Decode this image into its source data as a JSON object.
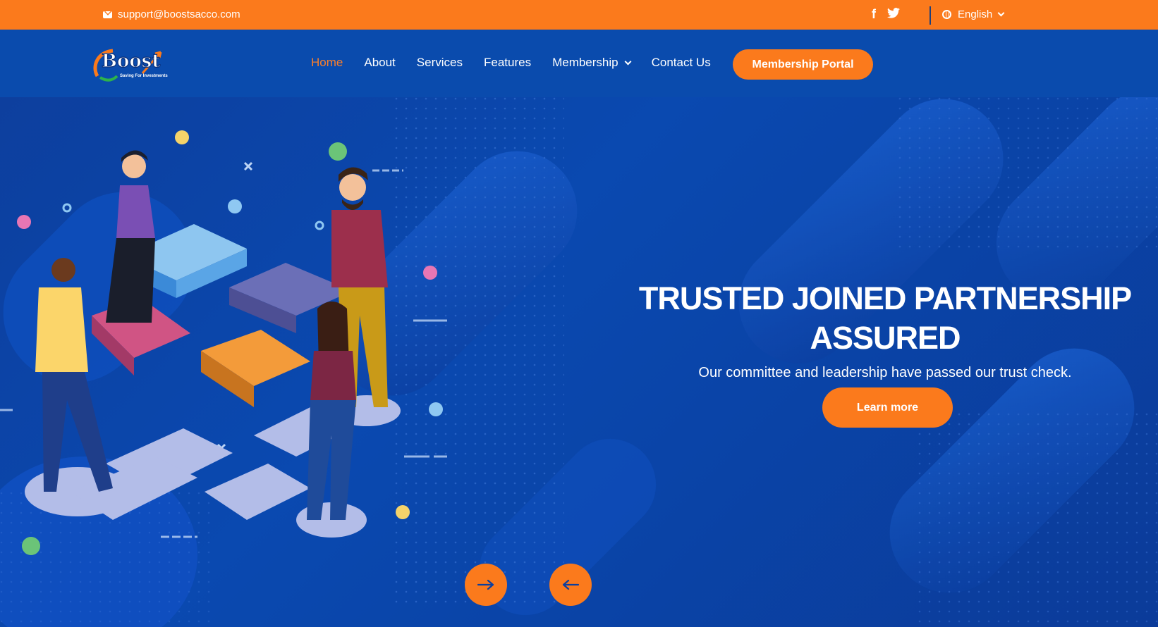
{
  "topbar": {
    "email": "support@boostsacco.com",
    "email_icon": "envelope-icon",
    "social": [
      {
        "name": "facebook-icon",
        "glyph": "f"
      },
      {
        "name": "twitter-icon",
        "glyph": "𝕏"
      }
    ],
    "language": "English"
  },
  "brand": {
    "logo_text": "Boost",
    "tagline": "Saving For Investments"
  },
  "nav": {
    "items": [
      {
        "label": "Home"
      },
      {
        "label": "About"
      },
      {
        "label": "Services"
      },
      {
        "label": "Features"
      },
      {
        "label": "Membership"
      },
      {
        "label": "Contact Us"
      }
    ],
    "active_item": "Home",
    "portal_label": "Membership Portal"
  },
  "hero": {
    "title_line1": "TRUSTED JOINED PARTNERSHIP",
    "title_line2": "ASSURED",
    "subtitle": "Our committee and leadership have passed our trust check.",
    "cta_label": "Learn more",
    "next_icon": "arrow-right-icon",
    "prev_icon": "arrow-left-icon"
  },
  "colors": {
    "accent": "#fb7a1c",
    "nav_bg": "#0a4bad",
    "hero_bg": "#0a47a8"
  }
}
